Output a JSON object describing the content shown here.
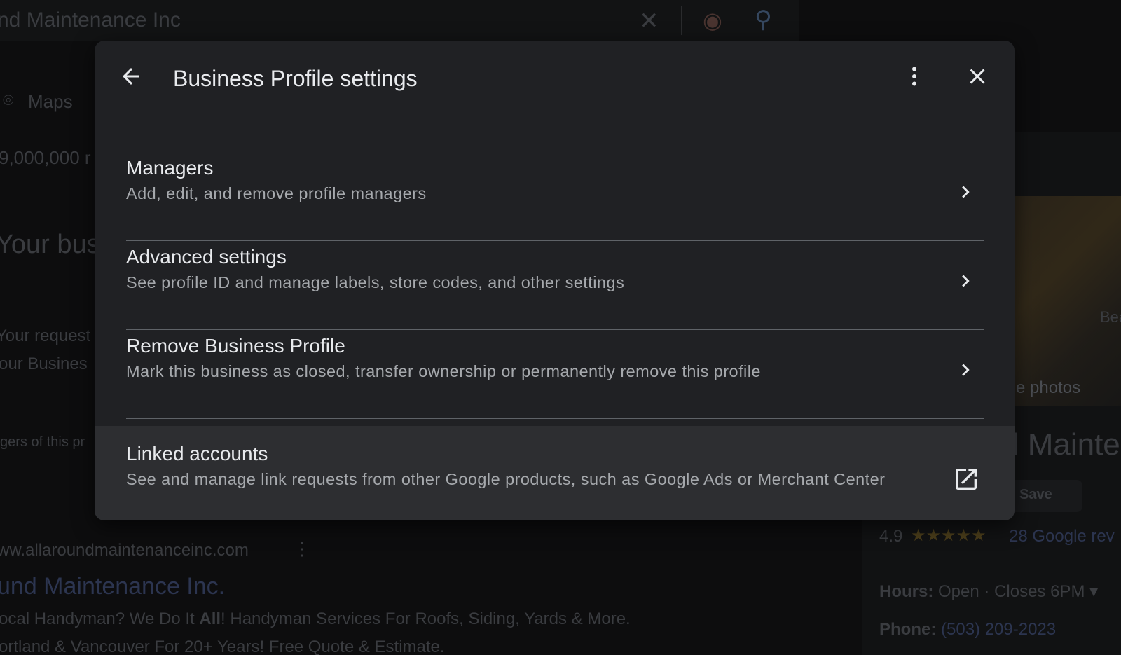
{
  "background": {
    "search_query": "nd Maintenance Inc",
    "tab_maps": "Maps",
    "results_count": "9,000,000 r",
    "your_business_heading": "Your bus",
    "request_line_1": "Your request",
    "request_line_2": "our Busines",
    "managers_line": "gers of this pr",
    "site_url": "ww.allaroundmaintenanceinc.com",
    "result_title": "und Maintenance Inc.",
    "snippet_1_pre": "ocal Handyman? We Do It ",
    "snippet_1_bold": "All",
    "snippet_1_post": "! Handyman Services For Roofs, Siding, Yards & More.",
    "snippet_2": "ortland & Vancouver For 20+ Years! Free Quote & Estimate.",
    "photos_link": "e photos",
    "photo_text": "Bea",
    "panel_title": "d Mainte",
    "save_label": "Save",
    "rating": "4.9",
    "stars": "★★★★★",
    "reviews": "28 Google rev",
    "hours_label": "Hours:",
    "hours_value": "Open · Closes 6PM ▾",
    "phone_label": "Phone:",
    "phone_value": "(503) 209-2023"
  },
  "dialog": {
    "title": "Business Profile settings",
    "items": [
      {
        "title": "Managers",
        "description": "Add, edit, and remove profile managers",
        "icon": "chevron-right-icon"
      },
      {
        "title": "Advanced settings",
        "description": "See profile ID and manage labels, store codes, and other settings",
        "icon": "chevron-right-icon"
      },
      {
        "title": "Remove Business Profile",
        "description": "Mark this business as closed, transfer ownership or permanently remove this profile",
        "icon": "chevron-right-icon"
      },
      {
        "title": "Linked accounts",
        "description": "See and manage link requests from other Google products, such as Google Ads or Merchant Center",
        "icon": "open-in-new-icon"
      }
    ]
  },
  "colors": {
    "dialog_bg": "#202124",
    "highlight_row_bg": "#2d2e31",
    "primary_text": "#e8eaed",
    "secondary_text": "#a6a9ad",
    "divider": "#5f6368"
  }
}
